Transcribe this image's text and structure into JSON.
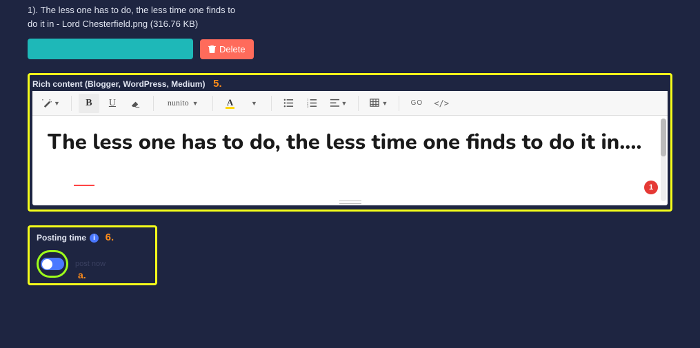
{
  "file": {
    "item_number": "1).",
    "name": "The less one has to do, the less time one finds to do it in - Lord Chesterfield.png",
    "size": "(316.76 KB)"
  },
  "delete_label": "Delete",
  "editor": {
    "label": "Rich content (Blogger, WordPress, Medium)",
    "annot": "5.",
    "font_name": "nunito",
    "color_letter": "A",
    "go_label": "GO",
    "code_label": "</>",
    "content": "The less one has to do, the less time one finds to do it in....",
    "badge": "1"
  },
  "posting": {
    "label": "Posting time",
    "info": "i",
    "annot": "6.",
    "toggle_text": "post now",
    "annot_a": "a."
  }
}
